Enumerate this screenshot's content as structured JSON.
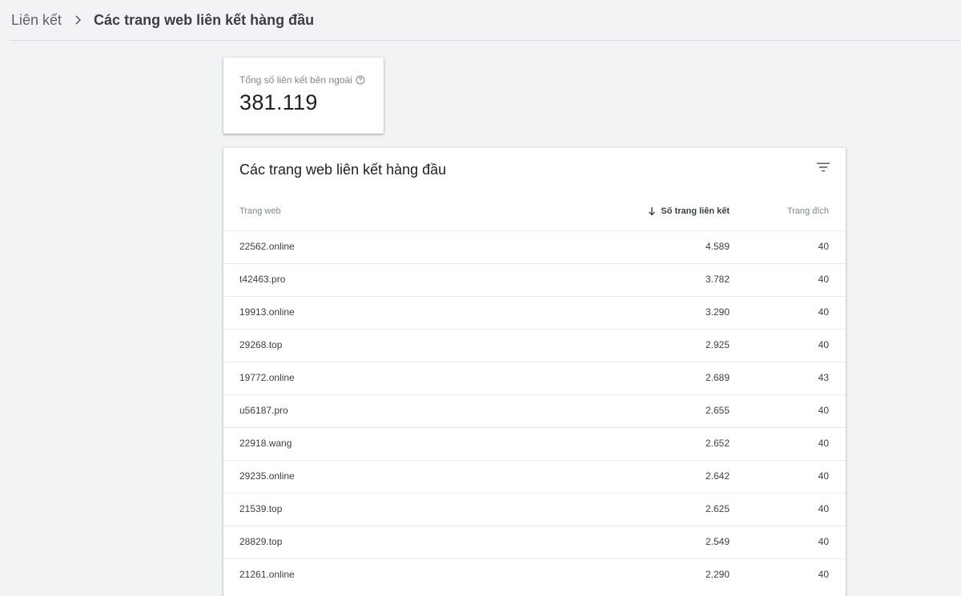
{
  "breadcrumb": {
    "root": "Liên kết",
    "current": "Các trang web liên kết hàng đầu"
  },
  "stat": {
    "label": "Tổng số liên kết bên ngoài",
    "value": "381.119"
  },
  "table": {
    "title": "Các trang web liên kết hàng đầu",
    "columns": {
      "site": "Trang web",
      "links": "Số trang liên kết",
      "target": "Trang đích"
    },
    "rows": [
      {
        "site": "22562.online",
        "links": "4.589",
        "target": "40"
      },
      {
        "site": "t42463.pro",
        "links": "3.782",
        "target": "40"
      },
      {
        "site": "19913.online",
        "links": "3.290",
        "target": "40"
      },
      {
        "site": "29268.top",
        "links": "2.925",
        "target": "40"
      },
      {
        "site": "19772.online",
        "links": "2.689",
        "target": "43"
      },
      {
        "site": "u56187.pro",
        "links": "2.655",
        "target": "40"
      },
      {
        "site": "22918.wang",
        "links": "2.652",
        "target": "40"
      },
      {
        "site": "29235.online",
        "links": "2.642",
        "target": "40"
      },
      {
        "site": "21539.top",
        "links": "2.625",
        "target": "40"
      },
      {
        "site": "28829.top",
        "links": "2.549",
        "target": "40"
      },
      {
        "site": "21261.online",
        "links": "2.290",
        "target": "40"
      }
    ]
  },
  "icons": {
    "breadcrumb_separator": "chevron-right-icon",
    "help": "help-circle-icon",
    "filter": "filter-icon",
    "sort": "arrow-down-icon"
  },
  "colors": {
    "background": "#f1f3f4",
    "card": "#ffffff",
    "divider": "#e8eaed",
    "muted_text": "#80868b"
  }
}
